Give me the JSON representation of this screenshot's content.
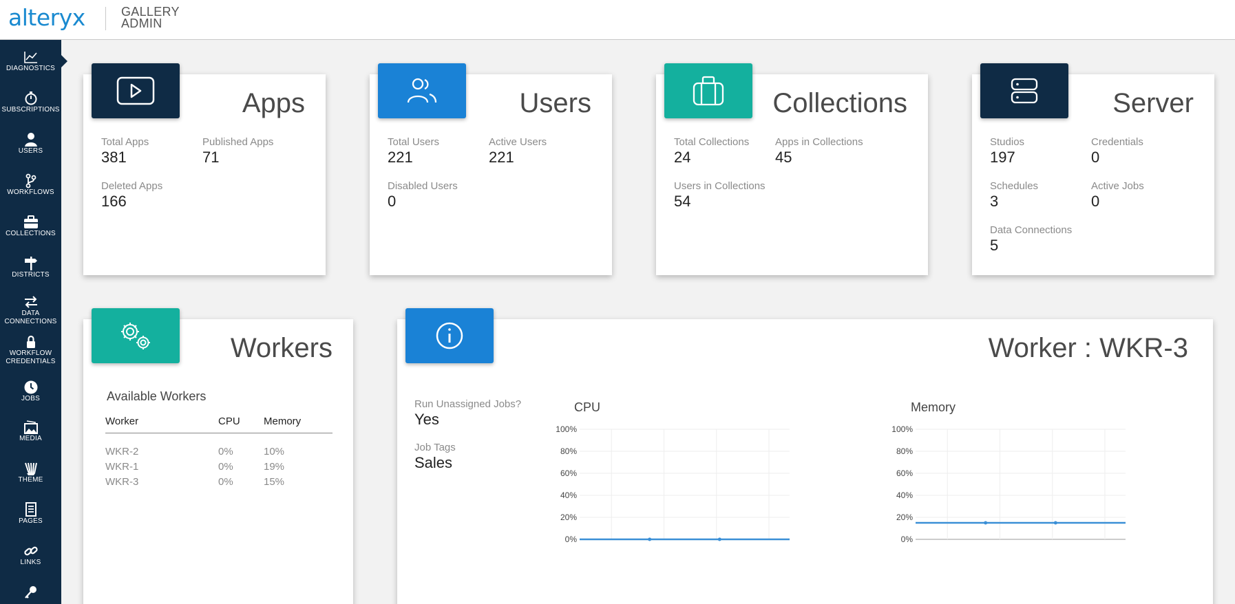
{
  "header": {
    "logo_text": "alteryx",
    "subtitle_line1": "GALLERY",
    "subtitle_line2": "ADMIN"
  },
  "sidebar": {
    "items": [
      {
        "label": "DIAGNOSTICS",
        "icon": "chart-line-icon",
        "active": true
      },
      {
        "label": "SUBSCRIPTIONS",
        "icon": "stopwatch-icon"
      },
      {
        "label": "USERS",
        "icon": "user-icon"
      },
      {
        "label": "WORKFLOWS",
        "icon": "branch-icon"
      },
      {
        "label": "COLLECTIONS",
        "icon": "briefcase-icon"
      },
      {
        "label": "DISTRICTS",
        "icon": "signpost-icon"
      },
      {
        "label": "DATA",
        "label2": "CONNECTIONS",
        "icon": "exchange-icon"
      },
      {
        "label": "WORKFLOW",
        "label2": "CREDENTIALS",
        "icon": "lock-icon"
      },
      {
        "label": "JOBS",
        "icon": "clock-icon"
      },
      {
        "label": "MEDIA",
        "icon": "media-icon"
      },
      {
        "label": "THEME",
        "icon": "theme-icon"
      },
      {
        "label": "PAGES",
        "icon": "page-icon"
      },
      {
        "label": "LINKS",
        "icon": "link-icon"
      },
      {
        "label": "",
        "icon": "key-icon"
      }
    ]
  },
  "cards": {
    "apps": {
      "title": "Apps",
      "icon": "play-icon",
      "stats": [
        {
          "label": "Total Apps",
          "value": "381"
        },
        {
          "label": "Published Apps",
          "value": "71"
        },
        {
          "label": "Deleted Apps",
          "value": "166"
        }
      ]
    },
    "users": {
      "title": "Users",
      "icon": "users-icon",
      "stats": [
        {
          "label": "Total Users",
          "value": "221"
        },
        {
          "label": "Active Users",
          "value": "221"
        },
        {
          "label": "Disabled Users",
          "value": "0"
        }
      ]
    },
    "collections": {
      "title": "Collections",
      "icon": "briefcase-icon",
      "stats": [
        {
          "label": "Total Collections",
          "value": "24"
        },
        {
          "label": "Apps in Collections",
          "value": "45"
        },
        {
          "label": "Users in Collections",
          "value": "54"
        }
      ]
    },
    "server": {
      "title": "Server",
      "icon": "server-icon",
      "stats": [
        {
          "label": "Studios",
          "value": "197"
        },
        {
          "label": "Credentials",
          "value": "0"
        },
        {
          "label": "Schedules",
          "value": "3"
        },
        {
          "label": "Active Jobs",
          "value": "0"
        },
        {
          "label": "Data Connections",
          "value": "5"
        }
      ]
    },
    "workers": {
      "title": "Workers",
      "icon": "gears-icon",
      "heading": "Available Workers",
      "columns": [
        "Worker",
        "CPU",
        "Memory"
      ],
      "rows": [
        [
          "WKR-2",
          "0%",
          "10%"
        ],
        [
          "WKR-1",
          "0%",
          "19%"
        ],
        [
          "WKR-3",
          "0%",
          "15%"
        ]
      ]
    },
    "worker_detail": {
      "title": "Worker : WKR-3",
      "icon": "info-icon",
      "run_unassigned_label": "Run Unassigned Jobs?",
      "run_unassigned_value": "Yes",
      "job_tags_label": "Job Tags",
      "job_tags_value": "Sales"
    }
  },
  "colors": {
    "navy": "#0f2b45",
    "blue": "#1a82d6",
    "teal": "#14b09e",
    "line": "#3a8fd6"
  },
  "chart_data": [
    {
      "type": "line",
      "title": "CPU",
      "yticks": [
        "100%",
        "80%",
        "60%",
        "40%",
        "20%",
        "0%"
      ],
      "ylim": [
        0,
        100
      ],
      "x": [
        0,
        1,
        2,
        3
      ],
      "series": [
        {
          "values": [
            0,
            0,
            0,
            0
          ]
        }
      ],
      "grid": true
    },
    {
      "type": "line",
      "title": "Memory",
      "yticks": [
        "100%",
        "80%",
        "60%",
        "40%",
        "20%",
        "0%"
      ],
      "ylim": [
        0,
        100
      ],
      "x": [
        0,
        1,
        2,
        3
      ],
      "series": [
        {
          "values": [
            15,
            15,
            15,
            15
          ]
        }
      ],
      "grid": true
    }
  ]
}
